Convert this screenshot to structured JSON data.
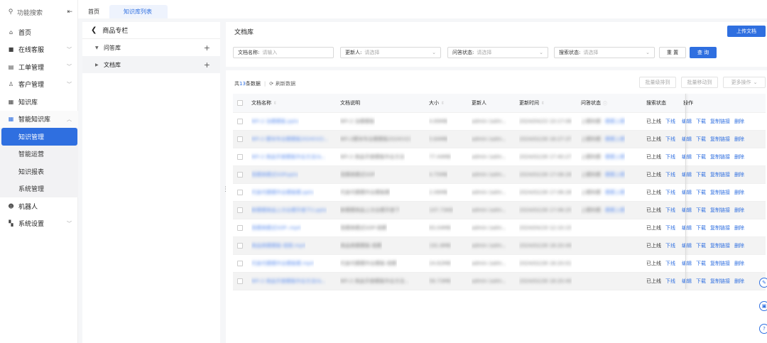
{
  "sidebar": {
    "search_placeholder": "功能搜索",
    "items": [
      {
        "label": "首页",
        "icon": "home-icon",
        "chevron": false
      },
      {
        "label": "在线客服",
        "icon": "chat-icon",
        "chevron": true
      },
      {
        "label": "工单管理",
        "icon": "ticket-icon",
        "chevron": true
      },
      {
        "label": "客户管理",
        "icon": "users-icon",
        "chevron": true
      },
      {
        "label": "知识库",
        "icon": "grid-icon",
        "chevron": false
      },
      {
        "label": "智能知识库",
        "icon": "smart-grid-icon",
        "chevron": true
      }
    ],
    "sub_items": [
      "知识管理",
      "智能运营",
      "知识报表",
      "系统管理"
    ],
    "items_after": [
      {
        "label": "机器人",
        "icon": "robot-icon",
        "chevron": false
      },
      {
        "label": "系统设置",
        "icon": "settings-icon",
        "chevron": true
      }
    ]
  },
  "tabs": [
    "首页",
    "知识库列表"
  ],
  "tree": {
    "title": "商品专栏",
    "nodes": [
      {
        "label": "问答库",
        "expanded": true
      },
      {
        "label": "文档库",
        "expanded": false
      }
    ]
  },
  "main": {
    "title": "文档库",
    "upload_label": "上传文档",
    "filters": {
      "name_label": "文档名称:",
      "name_placeholder": "请输入",
      "updater_label": "更新人:",
      "updater_placeholder": "请选择",
      "qa_label": "问答状态:",
      "qa_placeholder": "请选择",
      "search_label": "搜索状态:",
      "search_placeholder": "请选择",
      "reset_label": "重 置",
      "query_label": "查 询"
    },
    "toolbar": {
      "prefix": "共",
      "count": "13",
      "suffix": "条数据",
      "refresh": "刷新数据",
      "batch_offline": "批量级排到",
      "batch_move": "批量移动到",
      "more": "更多操作"
    },
    "columns": {
      "name": "文档名称",
      "desc": "文档说明",
      "size": "大小",
      "updater": "更新人",
      "time": "更新时间",
      "qa": "问答状态",
      "search": "搜索状态",
      "ops": "操作"
    },
    "actions": [
      "下线",
      "编辑",
      "下载",
      "复制链接",
      "删除"
    ],
    "rows": [
      {
        "name": "NFI-2 治模模板.pptx",
        "desc": "NFI-2 治模模板",
        "size": "4.89MB",
        "updater": "admin (adm...",
        "time": "2024/04/23 10:17:06",
        "qa": "上模利模",
        "qa_link": "模模上模",
        "search": "已上线"
      },
      {
        "name": "NFI-2 模块专业模模板2024(V2)...",
        "desc": "NFI-2模块专业模模板2024(V2)",
        "size": "5.64MB",
        "updater": "admin (adm...",
        "time": "2024/02/28 18:27:37",
        "qa": "上模利模",
        "qa_link": "模模上模",
        "search": "已上线"
      },
      {
        "name": "NFI-2 商品手册模板作业方法(&...",
        "desc": "NFI-2 商品手册模板作业方法",
        "size": "77.44MB",
        "updater": "admin (adm...",
        "time": "2024/02/28 17:40:27",
        "qa": "上模利模",
        "qa_link": "模模上模",
        "search": "已上线"
      },
      {
        "name": "竞模商模式SOP.pptx",
        "desc": "竞模商模式SOP",
        "size": "4.75MB",
        "updater": "admin (adm...",
        "time": "2024/02/28 17:08:28",
        "qa": "上模利模",
        "qa_link": "模模上模",
        "search": "已上线"
      },
      {
        "name": "代金代模模作业模板模.pptx",
        "desc": "代金代模模作业模板模",
        "size": "2.06MB",
        "updater": "admin (adm...",
        "time": "2024/02/28 17:06:28",
        "qa": "上模利模",
        "qa_link": "模模上模",
        "search": "已上线"
      },
      {
        "name": "新模模商品上次业模手册下2.pptx",
        "desc": "新模模商品上次业模手册下",
        "size": "107.73KB",
        "updater": "admin (adm...",
        "time": "2024/02/28 17:06:25",
        "qa": "上模利模",
        "qa_link": "模模上模",
        "search": "已上线"
      },
      {
        "name": "竞模商模式SOP-.mp4",
        "desc": "竞模商模式SOP-视模",
        "size": "83.04MB",
        "updater": "admin (adm...",
        "time": "2024/04/19 12:10:15",
        "qa": "",
        "qa_link": "",
        "search": "已上线"
      },
      {
        "name": "商品商模模板-视频.mp4",
        "desc": "商品商模模板-视模",
        "size": "191.6MB",
        "updater": "admin (adm...",
        "time": "2024/02/28 18:20:49",
        "qa": "",
        "qa_link": "",
        "search": "已上线"
      },
      {
        "name": "代金代模模作业模板模.mp4",
        "desc": "代金代模模作业模板-视模",
        "size": "24.62MB",
        "updater": "admin (adm...",
        "time": "2024/02/28 18:20:01",
        "qa": "",
        "qa_link": "",
        "search": "已上线"
      },
      {
        "name": "NFI-2 商品手册模板作业方法(&...",
        "desc": "NFI-2 商品手册模板作业方法...",
        "size": "56.73MB",
        "updater": "admin (adm...",
        "time": "2024/02/28 18:20:49",
        "qa": "",
        "qa_link": "",
        "search": "已上线"
      }
    ]
  },
  "colors": {
    "accent": "#2f6fe0",
    "page_bg": "#f5f6f8"
  }
}
